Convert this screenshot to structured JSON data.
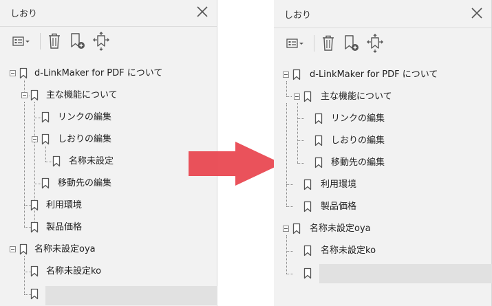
{
  "left_panel": {
    "title": "しおり",
    "items": [
      {
        "label": "d-LinkMaker for PDF について"
      },
      {
        "label": "主な機能について"
      },
      {
        "label": "リンクの編集"
      },
      {
        "label": "しおりの編集"
      },
      {
        "label": "名称未設定"
      },
      {
        "label": "移動先の編集"
      },
      {
        "label": "利用環境"
      },
      {
        "label": "製品価格"
      },
      {
        "label": "名称未設定oya"
      },
      {
        "label": "名称未設定ko"
      },
      {
        "label": ""
      }
    ]
  },
  "right_panel": {
    "title": "しおり",
    "items": [
      {
        "label": "d-LinkMaker for PDF について"
      },
      {
        "label": "主な機能について"
      },
      {
        "label": "リンクの編集"
      },
      {
        "label": "しおりの編集"
      },
      {
        "label": "移動先の編集"
      },
      {
        "label": "利用環境"
      },
      {
        "label": "製品価格"
      },
      {
        "label": "名称未設定oya"
      },
      {
        "label": "名称未設定ko"
      },
      {
        "label": ""
      }
    ]
  },
  "colors": {
    "arrow": "#e8434d",
    "panel_bg": "#f2f2f2",
    "selected_bg": "#e1e1e1"
  }
}
